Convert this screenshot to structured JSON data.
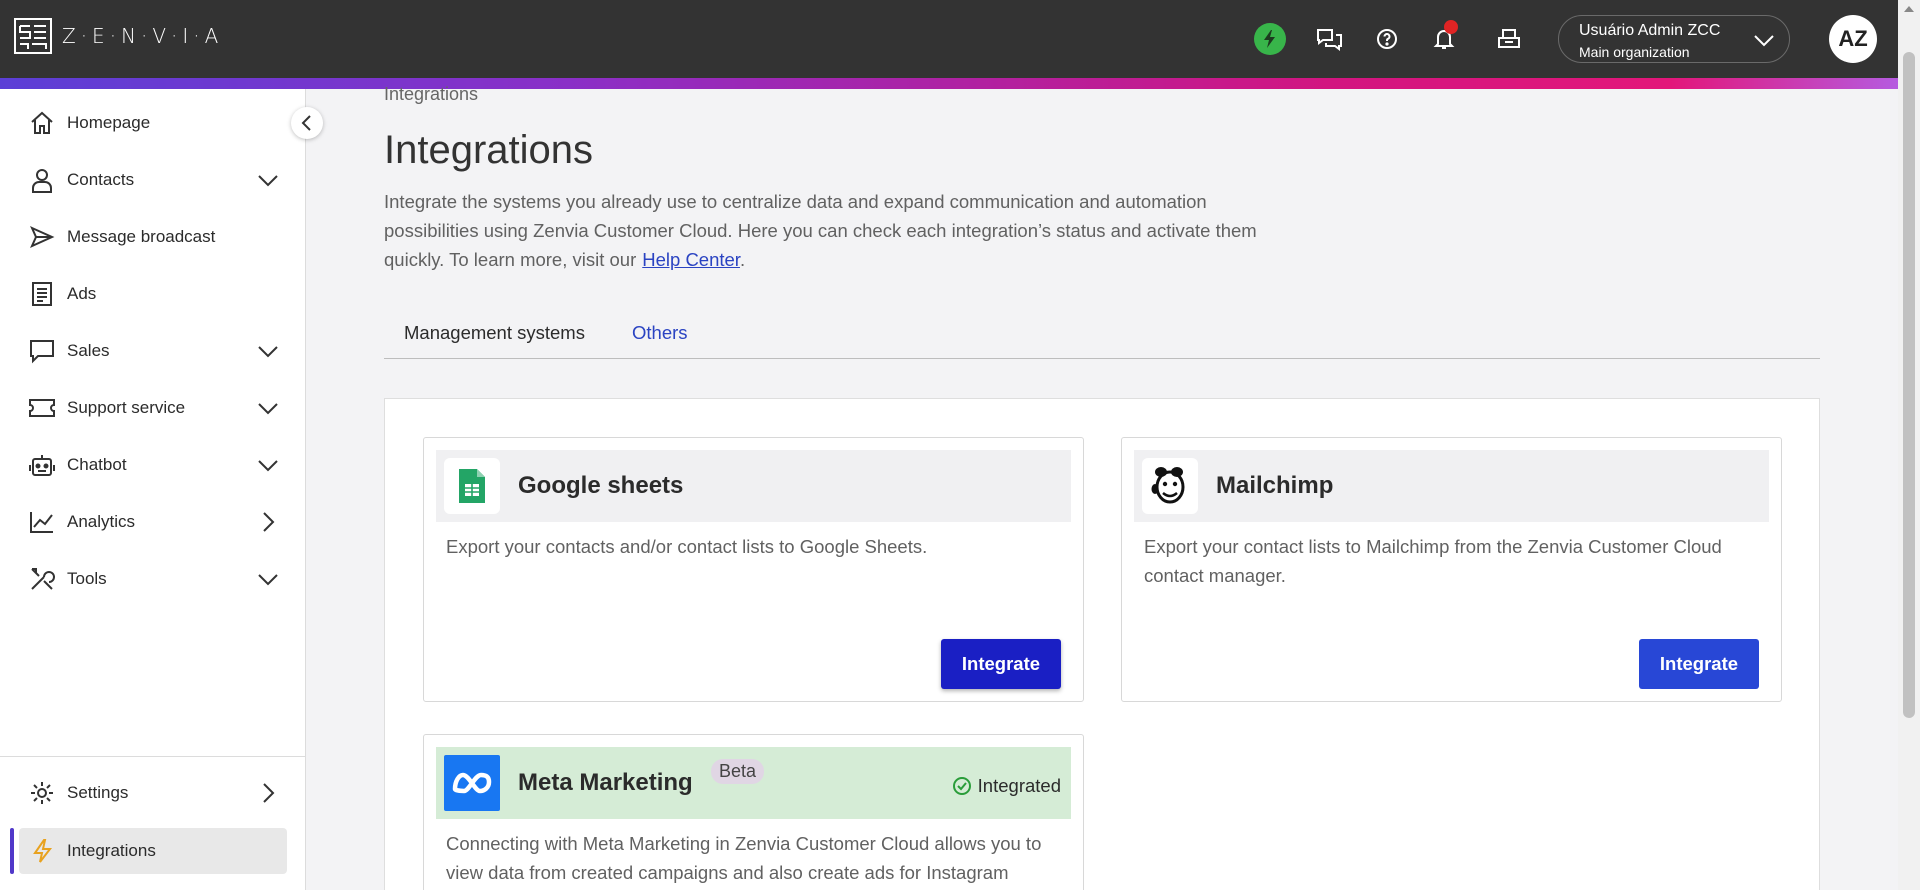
{
  "app": {
    "logo_text": "Z·E·N·V·I·A"
  },
  "header": {
    "user_name": "Usuário Admin ZCC",
    "user_org": "Main organization",
    "avatar_initials": "AZ"
  },
  "sidebar": {
    "items": [
      {
        "label": "Homepage",
        "icon": "home-icon"
      },
      {
        "label": "Contacts",
        "icon": "user-icon"
      },
      {
        "label": "Message broadcast",
        "icon": "send-icon"
      },
      {
        "label": "Ads",
        "icon": "document-icon"
      },
      {
        "label": "Sales",
        "icon": "chat-icon"
      },
      {
        "label": "Support service",
        "icon": "ticket-icon"
      },
      {
        "label": "Chatbot",
        "icon": "robot-icon"
      },
      {
        "label": "Analytics",
        "icon": "chart-icon"
      },
      {
        "label": "Tools",
        "icon": "tools-icon"
      }
    ],
    "bottom_items": [
      {
        "label": "Settings",
        "icon": "gear-icon"
      },
      {
        "label": "Integrations",
        "icon": "bolt-icon"
      }
    ]
  },
  "main": {
    "breadcrumb": "Integrations",
    "title": "Integrations",
    "description": "Integrate the systems you already use to centralize data and expand communication and automation possibilities using Zenvia Customer Cloud. Here you can check each integration’s status and activate them quickly. To learn more, visit our",
    "help_link": "Help Center",
    "description_end": ".",
    "tabs": [
      {
        "label": "Management systems",
        "active": true
      },
      {
        "label": "Others",
        "active": false
      }
    ],
    "cards": [
      {
        "title": "Google sheets",
        "description": "Export your contacts and/or contact lists to Google Sheets.",
        "button": "Integrate"
      },
      {
        "title": "Mailchimp",
        "description": "Export your contact lists to Mailchimp from the Zenvia Customer Cloud contact manager.",
        "button": "Integrate"
      },
      {
        "title": "Meta Marketing",
        "badge": "Beta",
        "status": "Integrated",
        "description": "Connecting with Meta Marketing in Zenvia Customer Cloud allows you to view data from created campaigns and also create ads for Instagram"
      }
    ]
  },
  "colors": {
    "topbar": "#333333",
    "accent_blue": "#2a43c2",
    "button_dark": "#1a1fc4",
    "button_blue": "#2847d6",
    "integrated_green_bg": "#d5ecd6",
    "status_green": "#38b54a"
  }
}
